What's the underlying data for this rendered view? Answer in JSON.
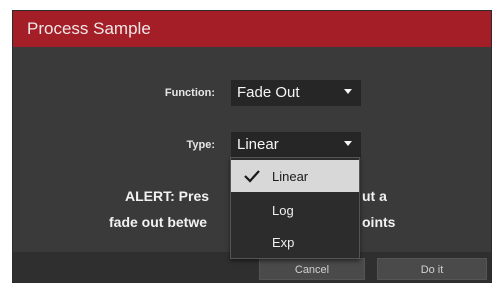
{
  "dialog": {
    "title": "Process Sample"
  },
  "function": {
    "label": "Function:",
    "value": "Fade Out"
  },
  "type": {
    "label": "Type:",
    "value": "Linear"
  },
  "alert": {
    "line1_left": "ALERT: Pres",
    "line1_right": "ut a",
    "line2_left": "fade out betwe",
    "line2_right": "oints"
  },
  "dropdown": {
    "options": [
      "Linear",
      "Log",
      "Exp"
    ],
    "selected": "Linear"
  },
  "buttons": {
    "cancel": "Cancel",
    "doit": "Do it"
  },
  "colors": {
    "titlebar": "#a41e27",
    "dialog_bg": "#3a3a3a",
    "selected_item_bg": "#d8d8d8"
  }
}
